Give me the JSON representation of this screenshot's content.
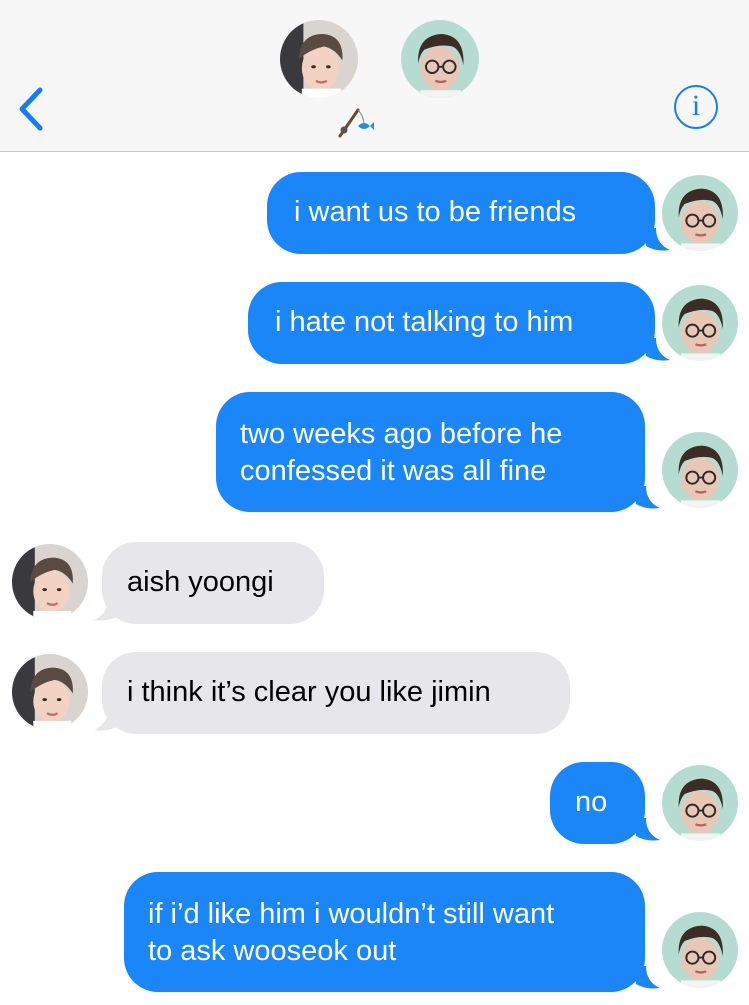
{
  "header": {
    "info_glyph": "i",
    "back_icon": "chevron-left-icon",
    "group_emoji": "fishing-pole-and-fish-emoji"
  },
  "colors": {
    "accent": "#1a7cf5",
    "outgoing": "#1a86f7",
    "incoming": "#e6e6eb"
  },
  "messages": [
    {
      "dir": "out",
      "text": "i want us to be friends"
    },
    {
      "dir": "out",
      "text": "i hate not talking to him"
    },
    {
      "dir": "out",
      "lines": [
        "two weeks ago before he",
        "confessed it was all fine"
      ]
    },
    {
      "dir": "in",
      "text": "aish yoongi"
    },
    {
      "dir": "in",
      "text": "i think it’s clear you like jimin"
    },
    {
      "dir": "out",
      "text": "no"
    },
    {
      "dir": "out",
      "lines": [
        "if i’d like him i wouldn’t still want",
        "to ask wooseok out"
      ]
    }
  ]
}
